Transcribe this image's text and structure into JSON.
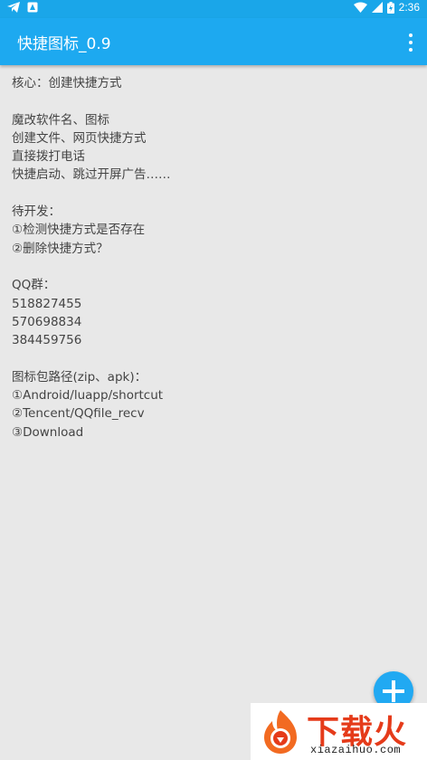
{
  "status_bar": {
    "time": "2:36",
    "icons": [
      "telegram-icon",
      "notification-icon",
      "wifi-icon",
      "signal-icon",
      "battery-icon"
    ]
  },
  "app_bar": {
    "title": "快捷图标_0.9",
    "menu_icon": "overflow-menu-icon"
  },
  "content": {
    "lines": [
      "核心：创建快捷方式",
      "",
      "魔改软件名、图标",
      "创建文件、网页快捷方式",
      "直接拨打电话",
      "快捷启动、跳过开屏广告……",
      "",
      "待开发：",
      "①检测快捷方式是否存在",
      "②删除快捷方式？",
      "",
      "QQ群：",
      "518827455",
      "570698834",
      "384459756",
      "",
      "图标包路径(zip、apk)：",
      "①Android/luapp/shortcut",
      "②Tencent/QQfile_recv",
      "③Download"
    ]
  },
  "fab": {
    "icon": "plus-icon"
  },
  "watermark": {
    "brand": "下载火",
    "url": "xiazaihuo.com"
  },
  "colors": {
    "status_bar": "#1aa6e9",
    "app_bar": "#1da9f0",
    "background": "#e8e8e8",
    "text": "#444444",
    "fab": "#21a9f2",
    "brand": "#e53b1a"
  }
}
